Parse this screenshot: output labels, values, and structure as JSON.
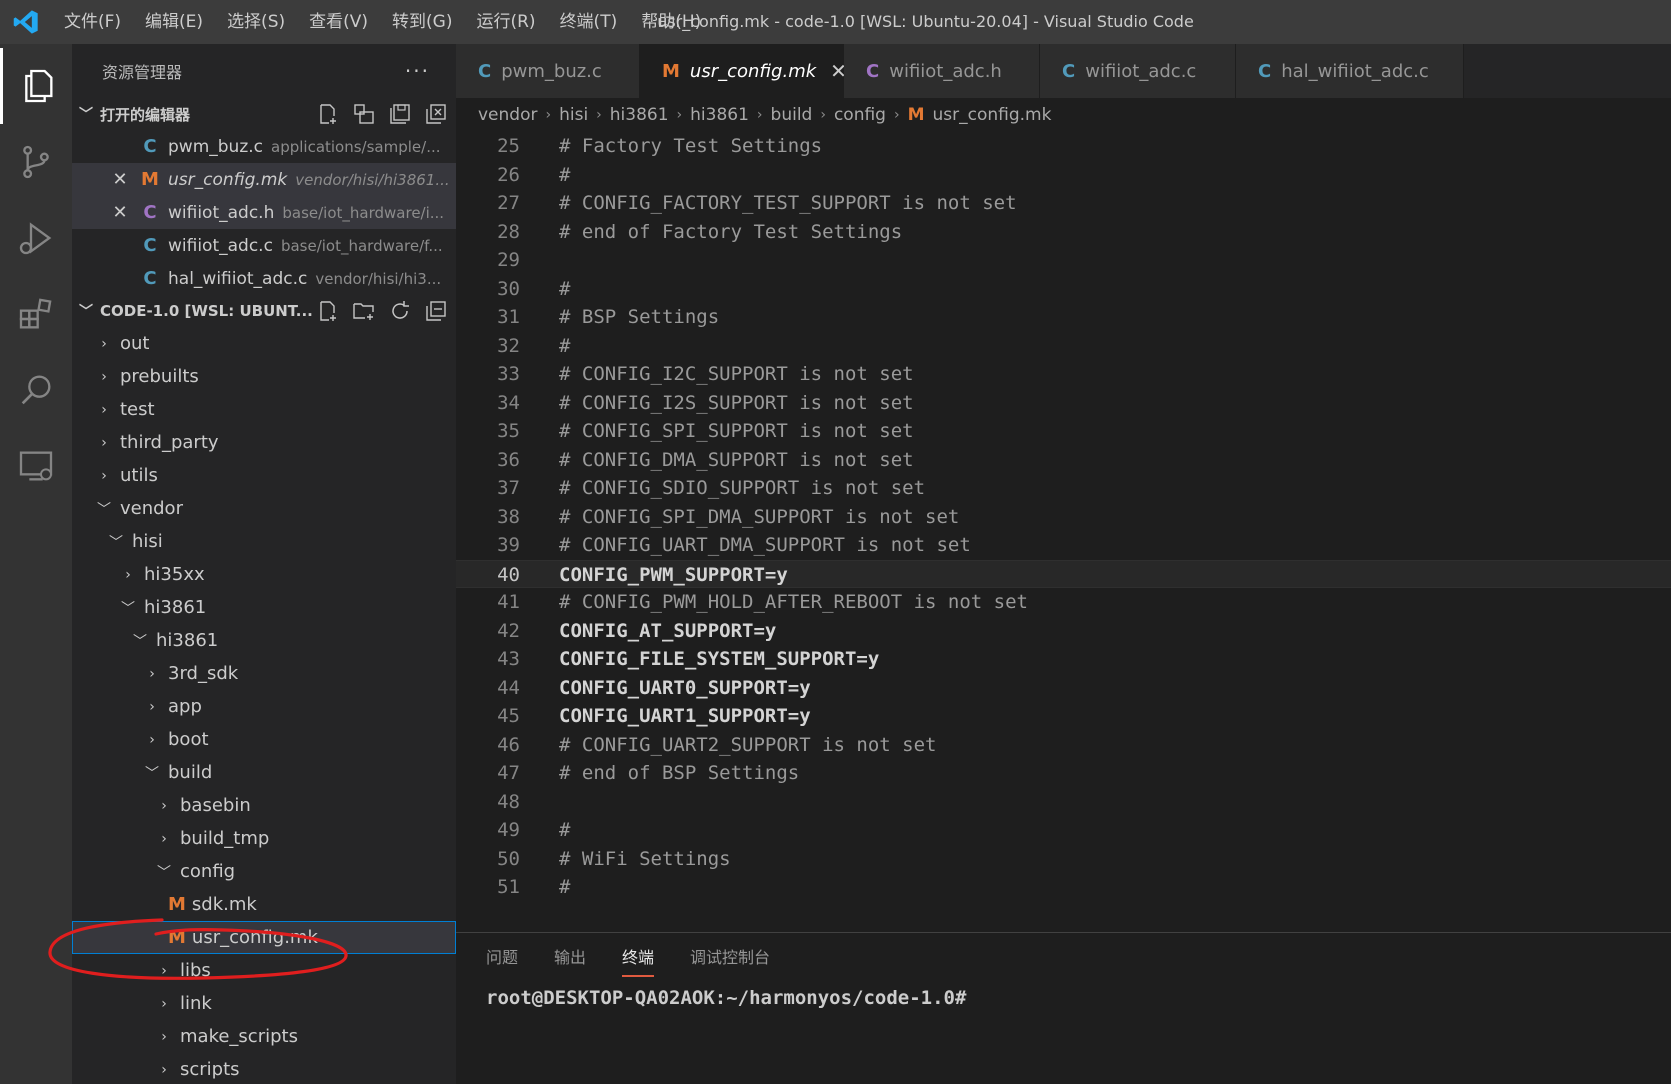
{
  "titlebar": {
    "menu": [
      "文件(F)",
      "编辑(E)",
      "选择(S)",
      "查看(V)",
      "转到(G)",
      "运行(R)",
      "终端(T)",
      "帮助(H)"
    ],
    "window_title": "usr_config.mk - code-1.0 [WSL: Ubuntu-20.04] - Visual Studio Code"
  },
  "activitybar": {
    "items": [
      "files-icon",
      "source-control-icon",
      "run-debug-icon",
      "extensions-icon",
      "search-icon",
      "remote-explorer-icon"
    ]
  },
  "sidebar": {
    "title": "资源管理器",
    "more": "···",
    "open_editors": {
      "label": "打开的编辑器",
      "items": [
        {
          "icon": "C",
          "name": "pwm_buz.c",
          "path": "applications/sample/..."
        },
        {
          "icon": "M",
          "name": "usr_config.mk",
          "path": "vendor/hisi/hi3861..."
        },
        {
          "icon": "C",
          "name": "wifiiot_adc.h",
          "path": "base/iot_hardware/i..."
        },
        {
          "icon": "C",
          "name": "wifiiot_adc.c",
          "path": "base/iot_hardware/f..."
        },
        {
          "icon": "C",
          "name": "hal_wifiiot_adc.c",
          "path": "vendor/hisi/hi3..."
        }
      ]
    },
    "workspace": {
      "label": "CODE-1.0 [WSL: UBUNT...",
      "tree": [
        {
          "label": "out",
          "expanded": false
        },
        {
          "label": "prebuilts",
          "expanded": false
        },
        {
          "label": "test",
          "expanded": false
        },
        {
          "label": "third_party",
          "expanded": false
        },
        {
          "label": "utils",
          "expanded": false
        },
        {
          "label": "vendor",
          "expanded": true
        },
        {
          "label": "hisi",
          "expanded": true
        },
        {
          "label": "hi35xx",
          "expanded": false
        },
        {
          "label": "hi3861",
          "expanded": true
        },
        {
          "label": "hi3861",
          "expanded": true
        },
        {
          "label": "3rd_sdk",
          "expanded": false
        },
        {
          "label": "app",
          "expanded": false
        },
        {
          "label": "boot",
          "expanded": false
        },
        {
          "label": "build",
          "expanded": true
        },
        {
          "label": "basebin",
          "expanded": false
        },
        {
          "label": "build_tmp",
          "expanded": false
        },
        {
          "label": "config",
          "expanded": true
        },
        {
          "label": "sdk.mk",
          "file": true
        },
        {
          "label": "usr_config.mk",
          "file": true
        },
        {
          "label": "libs",
          "expanded": false
        },
        {
          "label": "link",
          "expanded": false
        },
        {
          "label": "make_scripts",
          "expanded": false
        },
        {
          "label": "scripts",
          "expanded": false
        }
      ]
    }
  },
  "editor": {
    "tabs": [
      {
        "icon": "C",
        "label": "pwm_buz.c"
      },
      {
        "icon": "M",
        "label": "usr_config.mk"
      },
      {
        "icon": "C",
        "label": "wifiiot_adc.h"
      },
      {
        "icon": "C",
        "label": "wifiiot_adc.c"
      },
      {
        "icon": "C",
        "label": "hal_wifiiot_adc.c"
      }
    ],
    "close_glyph": "✕",
    "breadcrumb": [
      "vendor",
      "hisi",
      "hi3861",
      "hi3861",
      "build",
      "config"
    ],
    "breadcrumb_file_icon": "M",
    "breadcrumb_file": "usr_config.mk",
    "current_line": "40",
    "lines": [
      {
        "n": "25",
        "t": "# Factory Test Settings"
      },
      {
        "n": "26",
        "t": "#"
      },
      {
        "n": "27",
        "t": "# CONFIG_FACTORY_TEST_SUPPORT is not set"
      },
      {
        "n": "28",
        "t": "# end of Factory Test Settings"
      },
      {
        "n": "29",
        "t": ""
      },
      {
        "n": "30",
        "t": "#"
      },
      {
        "n": "31",
        "t": "# BSP Settings"
      },
      {
        "n": "32",
        "t": "#"
      },
      {
        "n": "33",
        "t": "# CONFIG_I2C_SUPPORT is not set"
      },
      {
        "n": "34",
        "t": "# CONFIG_I2S_SUPPORT is not set"
      },
      {
        "n": "35",
        "t": "# CONFIG_SPI_SUPPORT is not set"
      },
      {
        "n": "36",
        "t": "# CONFIG_DMA_SUPPORT is not set"
      },
      {
        "n": "37",
        "t": "# CONFIG_SDIO_SUPPORT is not set"
      },
      {
        "n": "38",
        "t": "# CONFIG_SPI_DMA_SUPPORT is not set"
      },
      {
        "n": "39",
        "t": "# CONFIG_UART_DMA_SUPPORT is not set"
      },
      {
        "n": "40",
        "t": "CONFIG_PWM_SUPPORT=y"
      },
      {
        "n": "41",
        "t": "# CONFIG_PWM_HOLD_AFTER_REBOOT is not set"
      },
      {
        "n": "42",
        "t": "CONFIG_AT_SUPPORT=y"
      },
      {
        "n": "43",
        "t": "CONFIG_FILE_SYSTEM_SUPPORT=y"
      },
      {
        "n": "44",
        "t": "CONFIG_UART0_SUPPORT=y"
      },
      {
        "n": "45",
        "t": "CONFIG_UART1_SUPPORT=y"
      },
      {
        "n": "46",
        "t": "# CONFIG_UART2_SUPPORT is not set"
      },
      {
        "n": "47",
        "t": "# end of BSP Settings"
      },
      {
        "n": "48",
        "t": ""
      },
      {
        "n": "49",
        "t": "#"
      },
      {
        "n": "50",
        "t": "# WiFi Settings"
      },
      {
        "n": "51",
        "t": "#"
      }
    ]
  },
  "panel": {
    "tabs": [
      "问题",
      "输出",
      "终端",
      "调试控制台"
    ],
    "active_tab": "终端",
    "terminal_prompt": "root@DESKTOP-QA02AOK:~/harmonyos/code-1.0#"
  },
  "colors": {
    "accent": "#007acc",
    "c_icon": "#519aba",
    "h_icon": "#a074c4",
    "mk_icon": "#e37933",
    "annotation": "#e01e1e"
  }
}
